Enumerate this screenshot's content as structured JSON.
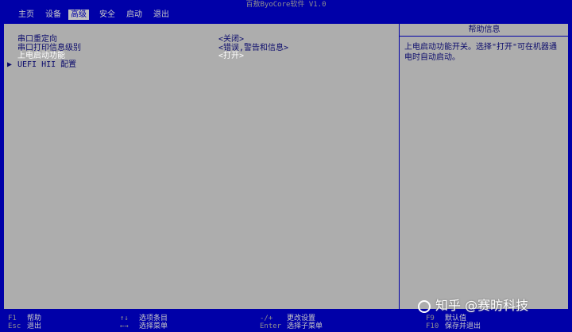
{
  "title": "百敖ByoCore软件 V1.0",
  "menu": [
    {
      "label": "主页",
      "active": false
    },
    {
      "label": "设备",
      "active": false
    },
    {
      "label": "高级",
      "active": true
    },
    {
      "label": "安全",
      "active": false
    },
    {
      "label": "启动",
      "active": false
    },
    {
      "label": "退出",
      "active": false
    }
  ],
  "settings": [
    {
      "label": "串口重定向",
      "value": "<关闭>"
    },
    {
      "label": "串口打印信息级别",
      "value": "<错误,警告和信息>"
    },
    {
      "label": "上电启动功能",
      "value": "<打开>",
      "selected": true
    },
    {
      "label": "UEFI HII 配置",
      "value": "",
      "submenu_arrow": "▶"
    }
  ],
  "help": {
    "header": "帮助信息",
    "text": "上电启动功能开关。选择\"打开\"可在机器通电时自动启动。"
  },
  "footer": [
    {
      "key": "F1",
      "desc": "帮助"
    },
    {
      "key": "Esc",
      "desc": "退出"
    },
    {
      "key": "↑↓",
      "desc": "选项条目"
    },
    {
      "key": "←→",
      "desc": "选择菜单"
    },
    {
      "key": "-/+",
      "desc": "更改设置"
    },
    {
      "key": "Enter",
      "desc": "选择子菜单"
    },
    {
      "key": "F9",
      "desc": "默认值"
    },
    {
      "key": "F10",
      "desc": "保存并退出"
    }
  ],
  "watermark": "知乎 @赛昉科技",
  "colors": {
    "background": "#0000a8",
    "panel": "#adadad",
    "text": "#0c0c6c",
    "highlight": "#ffffff"
  }
}
